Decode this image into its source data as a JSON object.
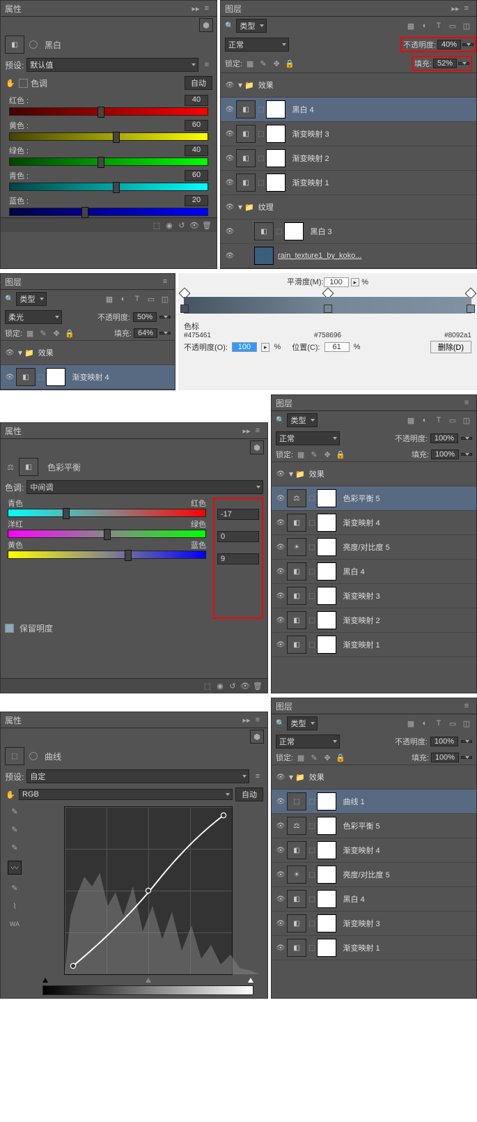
{
  "p1": {
    "props": {
      "title": "属性",
      "adj": "黑白",
      "preset_l": "预设:",
      "preset": "默认值",
      "tint": "色调",
      "auto": "自动",
      "sliders": [
        {
          "name": "红色 :",
          "val": "40",
          "grad": "linear-gradient(90deg,#400,#f00)"
        },
        {
          "name": "黄色 :",
          "val": "60",
          "grad": "linear-gradient(90deg,#440,#ff0)"
        },
        {
          "name": "绿色 :",
          "val": "40",
          "grad": "linear-gradient(90deg,#040,#0f0)"
        },
        {
          "name": "青色 :",
          "val": "60",
          "grad": "linear-gradient(90deg,#044,#0ff)"
        },
        {
          "name": "蓝色 :",
          "val": "20",
          "grad": "linear-gradient(90deg,#004,#00f)"
        }
      ]
    },
    "layers": {
      "title": "图层",
      "filter": "类型",
      "blend": "正常",
      "opac_l": "不透明度:",
      "opac": "40%",
      "lock_l": "锁定:",
      "fill_l": "填充:",
      "fill": "52%",
      "items": [
        {
          "type": "folder",
          "name": "效果",
          "sel": false
        },
        {
          "type": "adj",
          "name": "黑白 4",
          "sel": true,
          "icon": "◧"
        },
        {
          "type": "adj",
          "name": "渐变映射 3",
          "sel": false,
          "icon": "◧"
        },
        {
          "type": "adj",
          "name": "渐变映射 2",
          "sel": false,
          "icon": "◧"
        },
        {
          "type": "adj",
          "name": "渐变映射 1",
          "sel": false,
          "icon": "◧"
        },
        {
          "type": "folder",
          "name": "纹理",
          "sel": false
        },
        {
          "type": "adj",
          "name": "黑白 3",
          "sel": false,
          "icon": "◧",
          "indent": true
        },
        {
          "type": "img",
          "name": "rain_texture1_by_koko...",
          "sel": false,
          "indent": true
        }
      ]
    }
  },
  "p2": {
    "layers": {
      "title": "图层",
      "filter": "类型",
      "blend": "柔光",
      "opac_l": "不透明度:",
      "opac": "50%",
      "lock_l": "锁定:",
      "fill_l": "填充:",
      "fill": "64%",
      "items": [
        {
          "type": "folder",
          "name": "效果"
        },
        {
          "type": "adj",
          "name": "渐变映射 4",
          "sel": true,
          "icon": "◧"
        }
      ]
    },
    "grad": {
      "smooth_l": "平滑度(M):",
      "smooth": "100",
      "pct": "%",
      "stops_l": "色标",
      "c1": "#475461",
      "c2": "#758696",
      "c3": "#8092a1",
      "opac_l": "不透明度(O):",
      "opac": "100",
      "pos_l": "位置(C):",
      "pos": "61",
      "del": "删除(D)"
    }
  },
  "p3": {
    "props": {
      "title": "属性",
      "adj": "色彩平衡",
      "tone_l": "色调:",
      "tone": "中间调",
      "rows": [
        {
          "l": "青色",
          "r": "红色",
          "v": "-17",
          "grad": "linear-gradient(90deg,#0ff,#888,#f00)"
        },
        {
          "l": "洋红",
          "r": "绿色",
          "v": "0",
          "grad": "linear-gradient(90deg,#f0f,#888,#0f0)"
        },
        {
          "l": "黄色",
          "r": "蓝色",
          "v": "9",
          "grad": "linear-gradient(90deg,#ff0,#888,#00f)"
        }
      ],
      "preserve": "保留明度"
    },
    "layers": {
      "title": "图层",
      "filter": "类型",
      "blend": "正常",
      "opac_l": "不透明度:",
      "opac": "100%",
      "lock_l": "锁定:",
      "fill_l": "填充:",
      "fill": "100%",
      "items": [
        {
          "type": "folder",
          "name": "效果"
        },
        {
          "type": "adj",
          "name": "色彩平衡 5",
          "sel": true,
          "icon": "⚖"
        },
        {
          "type": "adj",
          "name": "渐变映射 4",
          "icon": "◧"
        },
        {
          "type": "adj",
          "name": "亮度/对比度 5",
          "icon": "☀"
        },
        {
          "type": "adj",
          "name": "黑白 4",
          "icon": "◧"
        },
        {
          "type": "adj",
          "name": "渐变映射 3",
          "icon": "◧"
        },
        {
          "type": "adj",
          "name": "渐变映射 2",
          "icon": "◧"
        },
        {
          "type": "adj",
          "name": "渐变映射 1",
          "icon": "◧"
        }
      ]
    }
  },
  "p4": {
    "props": {
      "title": "属性",
      "adj": "曲线",
      "preset_l": "预设:",
      "preset": "自定",
      "channel": "RGB",
      "auto": "自动"
    },
    "layers": {
      "title": "图层",
      "filter": "类型",
      "blend": "正常",
      "opac_l": "不透明度:",
      "opac": "100%",
      "lock_l": "锁定:",
      "fill_l": "填充:",
      "fill": "100%",
      "items": [
        {
          "type": "folder",
          "name": "效果"
        },
        {
          "type": "adj",
          "name": "曲线 1",
          "sel": true,
          "icon": "⬚"
        },
        {
          "type": "adj",
          "name": "色彩平衡 5",
          "icon": "⚖"
        },
        {
          "type": "adj",
          "name": "渐变映射 4",
          "icon": "◧"
        },
        {
          "type": "adj",
          "name": "亮度/对比度 5",
          "icon": "☀"
        },
        {
          "type": "adj",
          "name": "黑白 4",
          "icon": "◧"
        },
        {
          "type": "adj",
          "name": "渐变映射 3",
          "icon": "◧"
        },
        {
          "type": "adj",
          "name": "渐变映射 1",
          "icon": "◧"
        }
      ]
    }
  }
}
